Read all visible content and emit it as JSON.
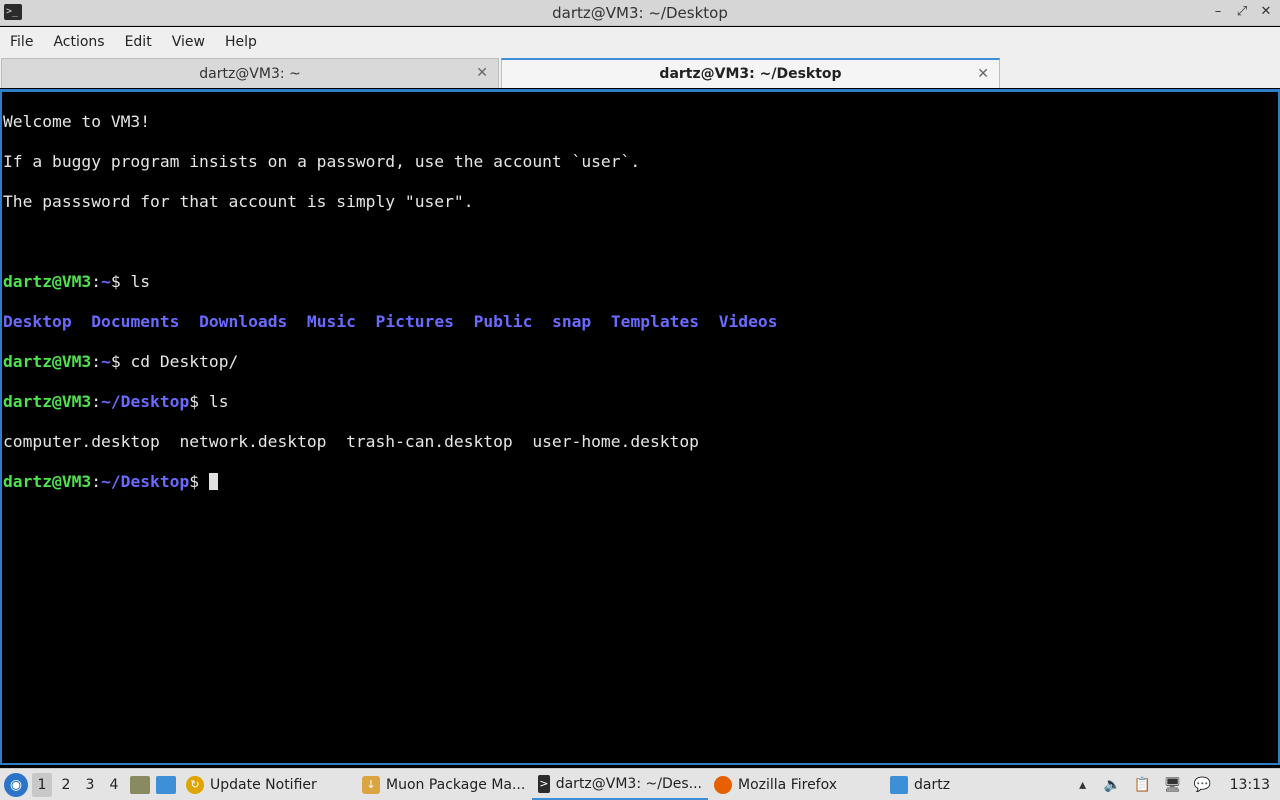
{
  "window": {
    "title": "dartz@VM3: ~/Desktop",
    "minimize": "–",
    "restore": "⤢",
    "close": "✕"
  },
  "menu": [
    "File",
    "Actions",
    "Edit",
    "View",
    "Help"
  ],
  "tabs": [
    {
      "label": "dartz@VM3: ~",
      "active": false
    },
    {
      "label": "dartz@VM3: ~/Desktop",
      "active": true
    }
  ],
  "terminal": {
    "motd": [
      "Welcome to VM3!",
      "If a buggy program insists on a password, use the account `user`.",
      "The passsword for that account is simply \"user\"."
    ],
    "prompt_user": "dartz@VM3",
    "prompt_colon": ":",
    "home_dir": "~",
    "desktop_dir": "~/Desktop",
    "dollar": "$",
    "cmd1": " ls",
    "ls_home": [
      "Desktop",
      "Documents",
      "Downloads",
      "Music",
      "Pictures",
      "Public",
      "snap",
      "Templates",
      "Videos"
    ],
    "cmd2": " cd Desktop/",
    "cmd3": " ls",
    "ls_desktop": "computer.desktop  network.desktop  trash-can.desktop  user-home.desktop"
  },
  "taskbar": {
    "desktops": [
      "1",
      "2",
      "3",
      "4"
    ],
    "tasks": [
      {
        "label": "Update Notifier",
        "color": "#e0a400"
      },
      {
        "label": "Muon Package Ma...",
        "color": "#d9a441"
      },
      {
        "label": "dartz@VM3: ~/Des...",
        "color": "#2b2b2b"
      },
      {
        "label": "Mozilla Firefox",
        "color": "#e66000"
      },
      {
        "label": "dartz",
        "color": "#3d8fd6"
      }
    ],
    "clock": "13:13"
  }
}
